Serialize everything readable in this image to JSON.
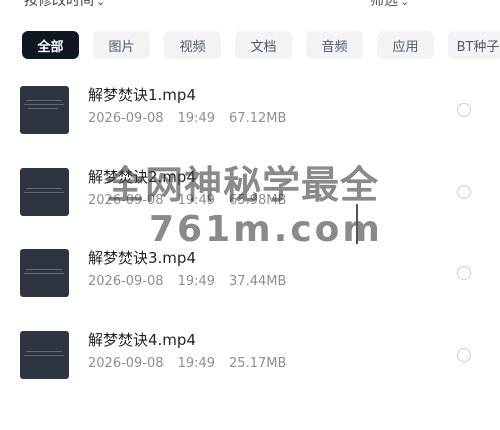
{
  "toolbar": {
    "sort_label": "按修改时间",
    "sort_chevron": "⌄",
    "filter_label": "筛选",
    "filter_suffix": "⌄"
  },
  "chips": [
    {
      "label": "全部",
      "active": true
    },
    {
      "label": "图片",
      "active": false
    },
    {
      "label": "视频",
      "active": false
    },
    {
      "label": "文档",
      "active": false
    },
    {
      "label": "音频",
      "active": false
    },
    {
      "label": "应用",
      "active": false
    },
    {
      "label": "BT种子",
      "active": false
    }
  ],
  "files": [
    {
      "name": "解梦焚诀1.mp4",
      "date": "2026-09-08",
      "time": "19:49",
      "size": "67.12MB"
    },
    {
      "name": "解梦焚诀2.mp4",
      "date": "2026-09-08",
      "time": "19:49",
      "size": "65.98MB"
    },
    {
      "name": "解梦焚诀3.mp4",
      "date": "2026-09-08",
      "time": "19:49",
      "size": "37.44MB"
    },
    {
      "name": "解梦焚诀4.mp4",
      "date": "2026-09-08",
      "time": "19:49",
      "size": "25.17MB"
    }
  ],
  "watermark": {
    "line1": "全网神秘学最全",
    "line2": "761m.com"
  }
}
